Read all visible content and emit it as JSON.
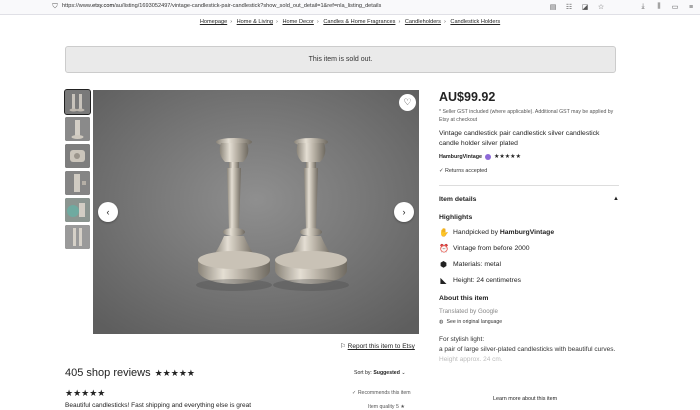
{
  "browser": {
    "url_prefix": "https://www.",
    "url_domain": "etsy.com",
    "url_rest": "/au/listing/1693052497/vintage-candlestick-pair-candlestick?show_sold_out_detail=1&ref=nla_listing_details"
  },
  "breadcrumb": [
    "Homepage",
    "Home & Living",
    "Home Decor",
    "Candles & Home Fragrances",
    "Candleholders",
    "Candlestick Holders"
  ],
  "banner": {
    "text": "This item is sold out."
  },
  "report": {
    "label": "Report this item to Etsy"
  },
  "reviews": {
    "title": "405 shop reviews",
    "stars": "★★★★★",
    "sort_label": "Sort by:",
    "sort_value": "Suggested",
    "review_stars": "★★★★★",
    "recommends": "Recommends this item",
    "text": "Beautiful candlesticks! Fast shipping and everything else is great",
    "item_quality": "Item quality",
    "item_quality_value": "5"
  },
  "listing": {
    "price": "AU$99.92",
    "gst_note": "* Seller GST included (where applicable). Additional GST may be applied by Etsy at checkout",
    "title": "Vintage candlestick pair candlestick silver candlestick candle holder silver plated",
    "shop_name": "HamburgVintage",
    "shop_stars": "★★★★★",
    "returns": "Returns accepted",
    "item_details": "Item details",
    "highlights_title": "Highlights",
    "highlights": [
      {
        "icon": "handpicked-icon",
        "prefix": "Handpicked by",
        "bold": "HamburgVintage"
      },
      {
        "icon": "clock-icon",
        "prefix": "Vintage from before 2000",
        "bold": ""
      },
      {
        "icon": "materials-icon",
        "prefix": "Materials: metal",
        "bold": ""
      },
      {
        "icon": "ruler-icon",
        "prefix": "Height: 24 centimetres",
        "bold": ""
      }
    ],
    "about_title": "About this item",
    "translated": "Translated by Google",
    "see_original": "See in original language",
    "desc_1": "For stylish light:",
    "desc_2": "a pair of large silver-plated candlesticks with beautiful curves.",
    "desc_3": "Height approx. 24 cm.",
    "learn_more": "Learn more about this item"
  }
}
